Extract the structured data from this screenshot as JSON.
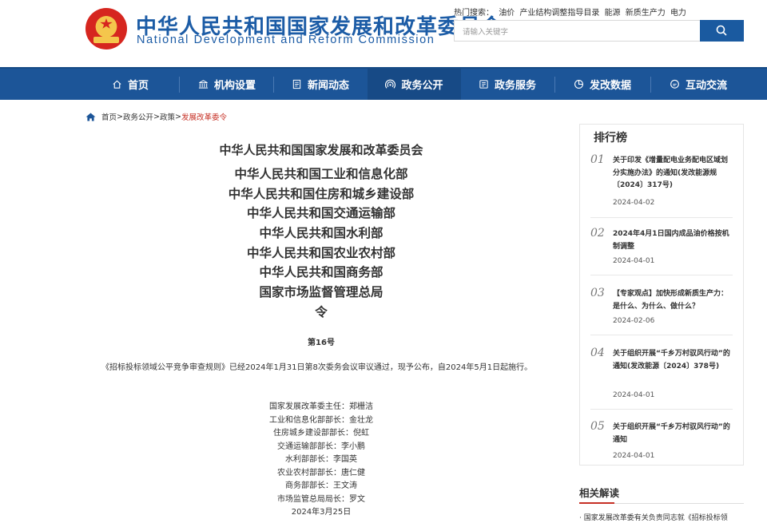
{
  "header": {
    "site_name_cn": "中华人民共和国国家发展和改革委员会",
    "site_name_en": "National Development and Reform Commission",
    "hot_search_label": "热门搜索：",
    "hot_search_items": [
      "油价",
      "产业结构调整指导目录",
      "能源",
      "新质生产力",
      "电力"
    ],
    "search_placeholder": "请输入关键字"
  },
  "nav": {
    "items": [
      {
        "label": "首页",
        "icon": "home-icon"
      },
      {
        "label": "机构设置",
        "icon": "building-icon"
      },
      {
        "label": "新闻动态",
        "icon": "news-icon"
      },
      {
        "label": "政务公开",
        "icon": "broadcast-icon",
        "active": true
      },
      {
        "label": "政务服务",
        "icon": "service-icon"
      },
      {
        "label": "发改数据",
        "icon": "data-icon"
      },
      {
        "label": "互动交流",
        "icon": "chat-icon"
      }
    ]
  },
  "breadcrumb": {
    "items": [
      "首页",
      "政务公开",
      "政策"
    ],
    "current": "发展改革委令",
    "separator": " > "
  },
  "article": {
    "issuer_main": "中华人民共和国国家发展和改革委员会",
    "issuers": [
      "中华人民共和国工业和信息化部",
      "中华人民共和国住房和城乡建设部",
      "中华人民共和国交通运输部",
      "中华人民共和国水利部",
      "中华人民共和国农业农村部",
      "中华人民共和国商务部",
      "国家市场监督管理总局"
    ],
    "ling": "令",
    "doc_no": "第16号",
    "paragraph": "《招标投标领域公平竞争审查规则》已经2024年1月31日第8次委务会议审议通过，现予公布，自2024年5月1日起施行。",
    "signatures": [
      "国家发展改革委主任：郑栅洁",
      "工业和信息化部部长：金壮龙",
      "住房城乡建设部部长：倪虹",
      "交通运输部部长：李小鹏",
      "水利部部长：李国英",
      "农业农村部部长：唐仁健",
      "商务部部长：王文涛",
      "市场监管总局局长：罗文",
      "2024年3月25日"
    ]
  },
  "ranking": {
    "title": "排行榜",
    "items": [
      {
        "num": "01",
        "title": "关于印发《增量配电业务配电区域划分实施办法》的通知(发改能源规〔2024〕317号)",
        "date": "2024-04-02"
      },
      {
        "num": "02",
        "title": "2024年4月1日国内成品油价格按机制调整",
        "date": "2024-04-01"
      },
      {
        "num": "03",
        "title": "【专家观点】加快形成新质生产力：是什么、为什么、做什么？",
        "date": "2024-02-06"
      },
      {
        "num": "04",
        "title": "关于组织开展“千乡万村驭风行动”的通知(发改能源〔2024〕378号)",
        "date": "2024-04-01"
      },
      {
        "num": "05",
        "title": "关于组织开展“千乡万村驭风行动”的通知",
        "date": "2024-04-01"
      }
    ]
  },
  "related": {
    "title": "相关解读",
    "items": [
      "国家发展改革委有关负责同志就《招标投标领"
    ]
  },
  "colors": {
    "brand_blue": "#1c5ca6",
    "nav_blue": "#1c5598",
    "accent_red": "#c62f24"
  }
}
